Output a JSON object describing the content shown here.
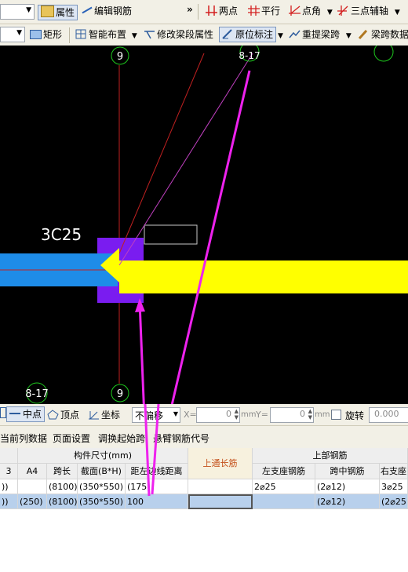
{
  "toolbar1": {
    "properties": "属性",
    "edit_rebar": "编辑钢筋",
    "overflow": "»",
    "two_points": "两点",
    "parallel": "平行",
    "point_angle": "点角",
    "three_point_axis": "三点辅轴"
  },
  "toolbar2": {
    "rectangle": "矩形",
    "smart_layout": "智能布置",
    "modify_segment_props": "修改梁段属性",
    "in_situ_annotation": "原位标注",
    "re_extract_span": "重提梁跨",
    "span_data_copy": "梁跨数据"
  },
  "canvas": {
    "axis_top": "9",
    "axis_top_partial": "8-17",
    "axis_bottom_left": "8-17",
    "axis_bottom": "9",
    "beam_label": "3C25"
  },
  "snapbar": {
    "midpoint": "中点",
    "vertex": "顶点",
    "coordinate": "坐标",
    "offset_mode": "不偏移",
    "x_label": "X=",
    "x_value": "0",
    "y_label": "Y=",
    "y_value": "0",
    "mm1": "mm",
    "mm2": "mm",
    "rotate": "旋转",
    "rotate_value": "0.000"
  },
  "tablebar": {
    "current_col": "当前列数据",
    "page_setup": "页面设置",
    "adjust_start_span": "调换起始跨",
    "cantilever_code": "悬臂钢筋代号"
  },
  "grid": {
    "group_component_size": "构件尺寸(mm)",
    "top_through": "上通长筋",
    "group_top_rebar": "上部钢筋",
    "headers": [
      "3",
      "A4",
      "跨长",
      "截面(B*H)",
      "距左边线距离",
      "左支座钢筋",
      "跨中钢筋",
      "右支座"
    ],
    "rows": [
      [
        "))",
        "",
        "(8100)",
        "(350*550)",
        "(175)",
        "",
        "2⌀25",
        "(2⌀12)",
        "3⌀25"
      ],
      [
        "))",
        "(250)",
        "(8100)",
        "(350*550)",
        "100",
        "",
        "",
        "(2⌀12)",
        "(2⌀25"
      ]
    ]
  }
}
